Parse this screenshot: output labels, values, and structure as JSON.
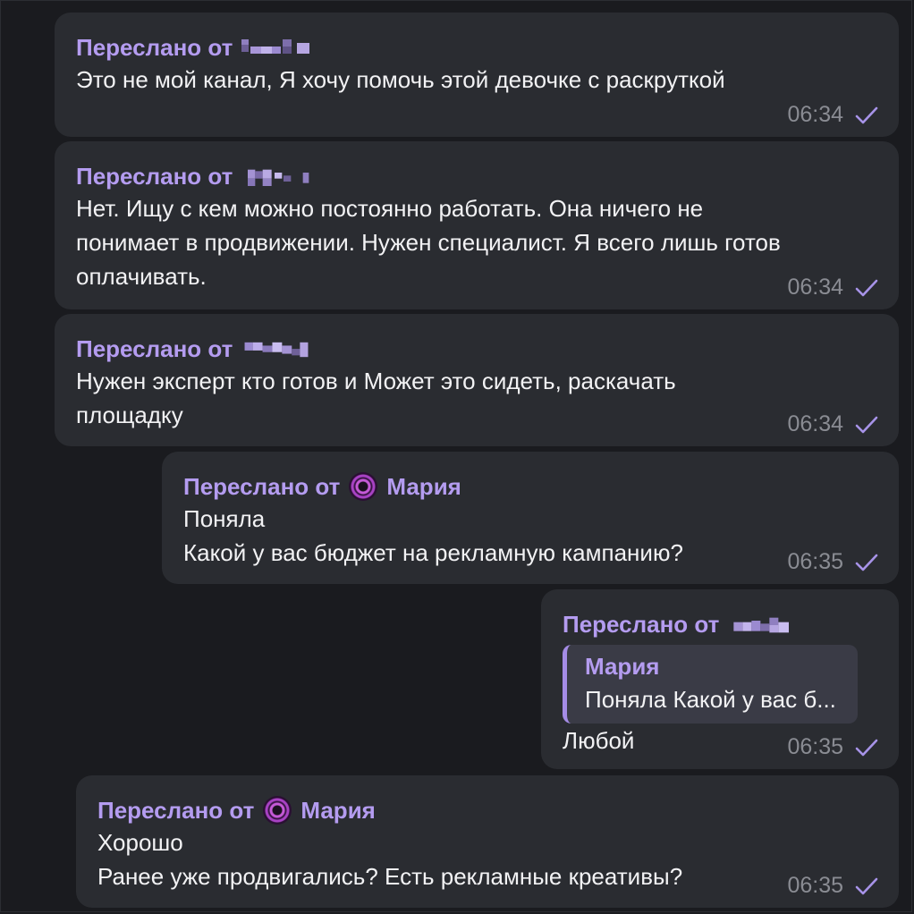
{
  "messages": [
    {
      "forward_label": "Переслано от",
      "forward_from": "",
      "text": "Это не мой канал, Я хочу помочь этой девочке с раскруткой",
      "time": "06:34"
    },
    {
      "forward_label": "Переслано от",
      "forward_from": "",
      "text": "Нет. Ищу с кем можно постоянно работать. Она ничего не\nпонимает в продвижении. Нужен специалист. Я всего лишь готов\nоплачивать.",
      "time": "06:34"
    },
    {
      "forward_label": "Переслано от",
      "forward_from": "",
      "text": "Нужен эксперт кто готов и Может это сидеть, раскачать\nплощадку",
      "time": "06:34"
    },
    {
      "forward_label": "Переслано от",
      "forward_from": "Мария",
      "text": "Поняла\nКакой у вас бюджет на рекламную кампанию?",
      "time": "06:35"
    },
    {
      "forward_label": "Переслано от",
      "forward_from": "",
      "quote_name": "Мария",
      "quote_text": "Поняла Какой у вас б...",
      "text": "Любой",
      "time": "06:35"
    },
    {
      "forward_label": "Переслано от",
      "forward_from": "Мария",
      "text": "Хорошо\nРанее уже продвигались? Есть рекламные креативы?",
      "time": "06:35"
    }
  ],
  "colors": {
    "background": "#1a1b1f",
    "bubble": "#2a2c31",
    "accent": "#b49cf0",
    "meta": "#8a8c93",
    "check": "#a793e8"
  },
  "icons": {
    "status": "check-icon",
    "avatar": "spiral-avatar-icon",
    "pixelated": "pixelated-name"
  }
}
